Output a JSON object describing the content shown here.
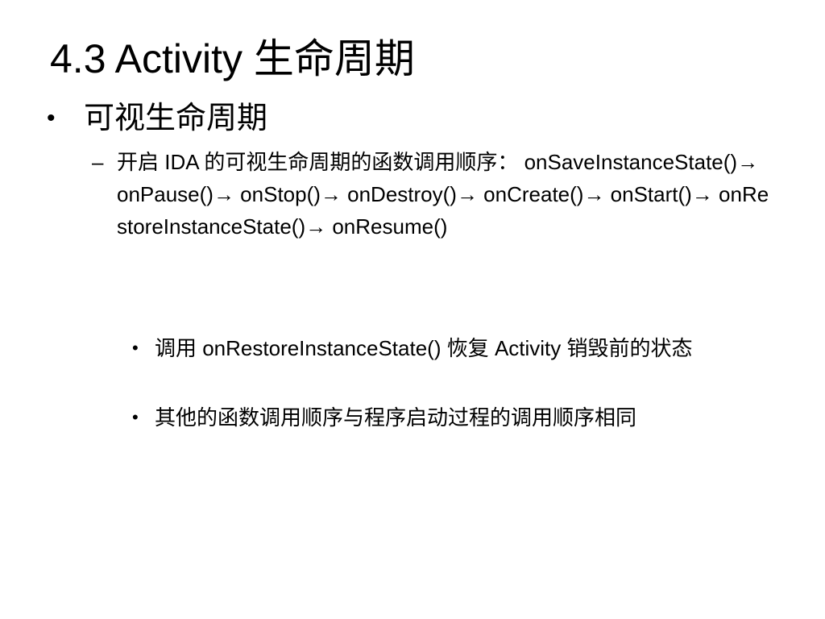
{
  "slide": {
    "title": "4.3 Activity 生命周期",
    "bullet_l1": "可视生命周期",
    "bullet_l2": "开启 IDA 的可视生命周期的函数调用顺序：   onSaveInstanceState()→ onPause()→ onStop()→ onDestroy()→ onCreate()→ onStart()→ onRestoreInstanceState()→ onResume()",
    "bullet_l3": [
      "调用 onRestoreInstanceState() 恢复 Activity 销毁前的状态",
      "其他的函数调用顺序与程序启动过程的调用顺序相同"
    ],
    "marker_bullet": "•",
    "marker_dash": "–"
  }
}
